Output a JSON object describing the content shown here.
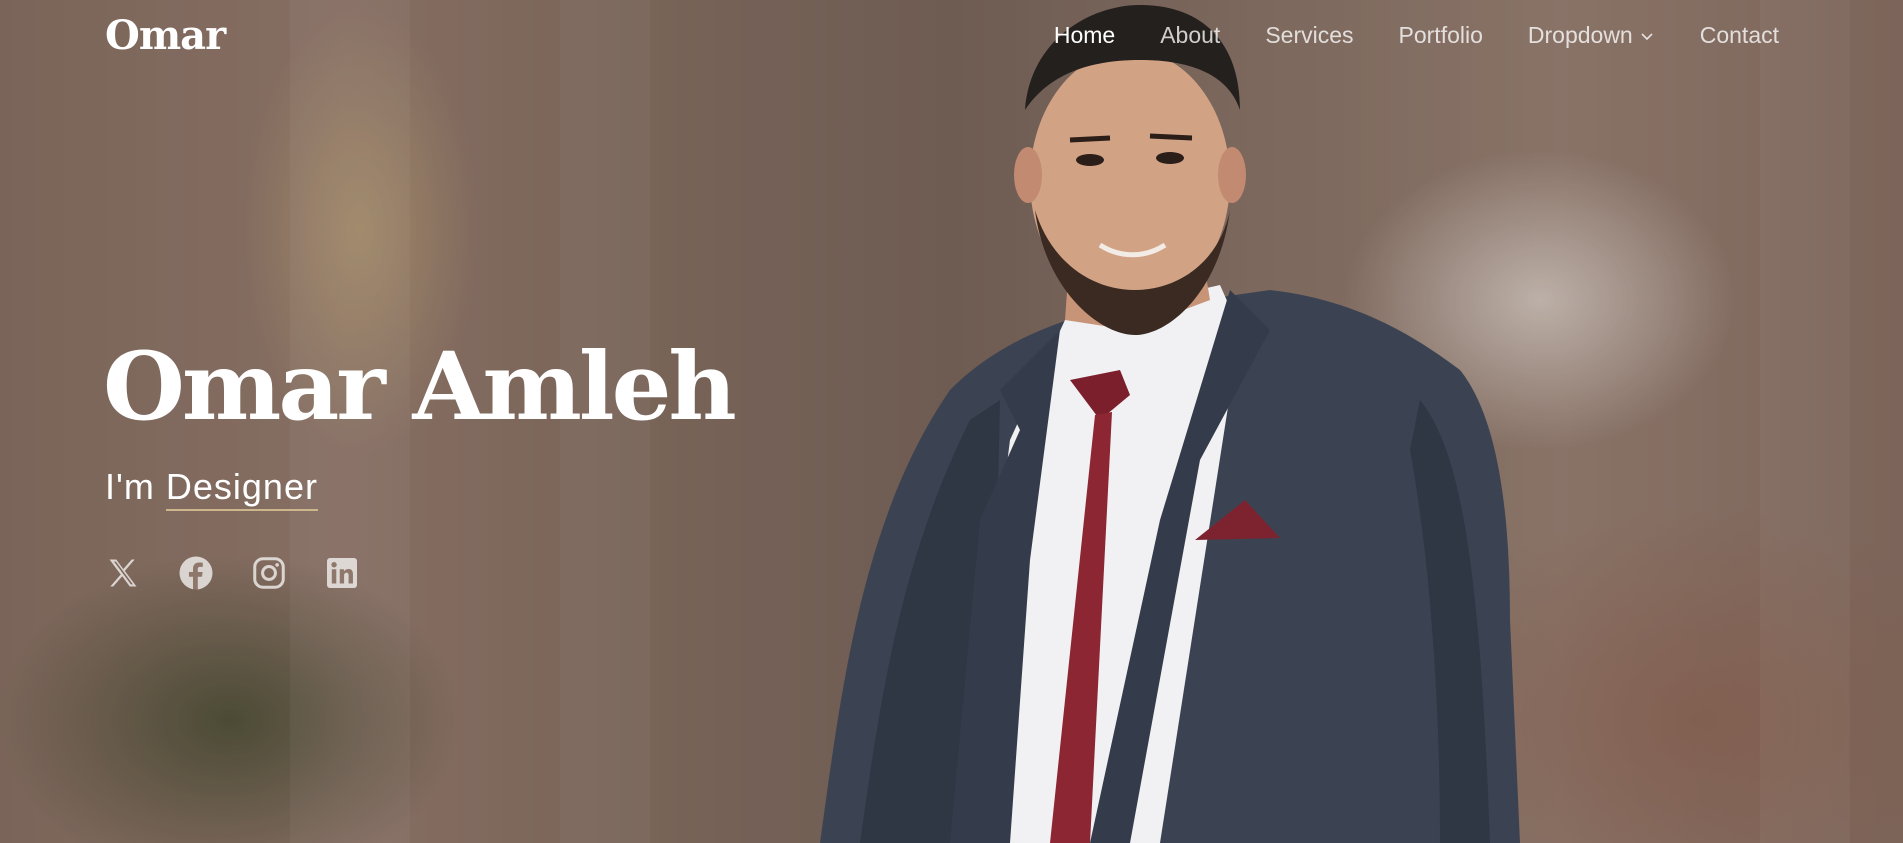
{
  "header": {
    "logo": "Omar",
    "nav": [
      {
        "label": "Home",
        "active": true
      },
      {
        "label": "About"
      },
      {
        "label": "Services"
      },
      {
        "label": "Portfolio"
      },
      {
        "label": "Dropdown",
        "has_submenu": true
      },
      {
        "label": "Contact"
      }
    ]
  },
  "hero": {
    "name": "Omar Amleh",
    "subtitle_prefix": "I'm",
    "subtitle_role": "Designer",
    "socials": [
      {
        "icon": "x-twitter-icon"
      },
      {
        "icon": "facebook-icon"
      },
      {
        "icon": "instagram-icon"
      },
      {
        "icon": "linkedin-icon"
      }
    ]
  },
  "colors": {
    "accent_underline": "#cdb68b",
    "nav_inactive": "rgba(255,255,255,0.78)",
    "text": "#ffffff"
  }
}
